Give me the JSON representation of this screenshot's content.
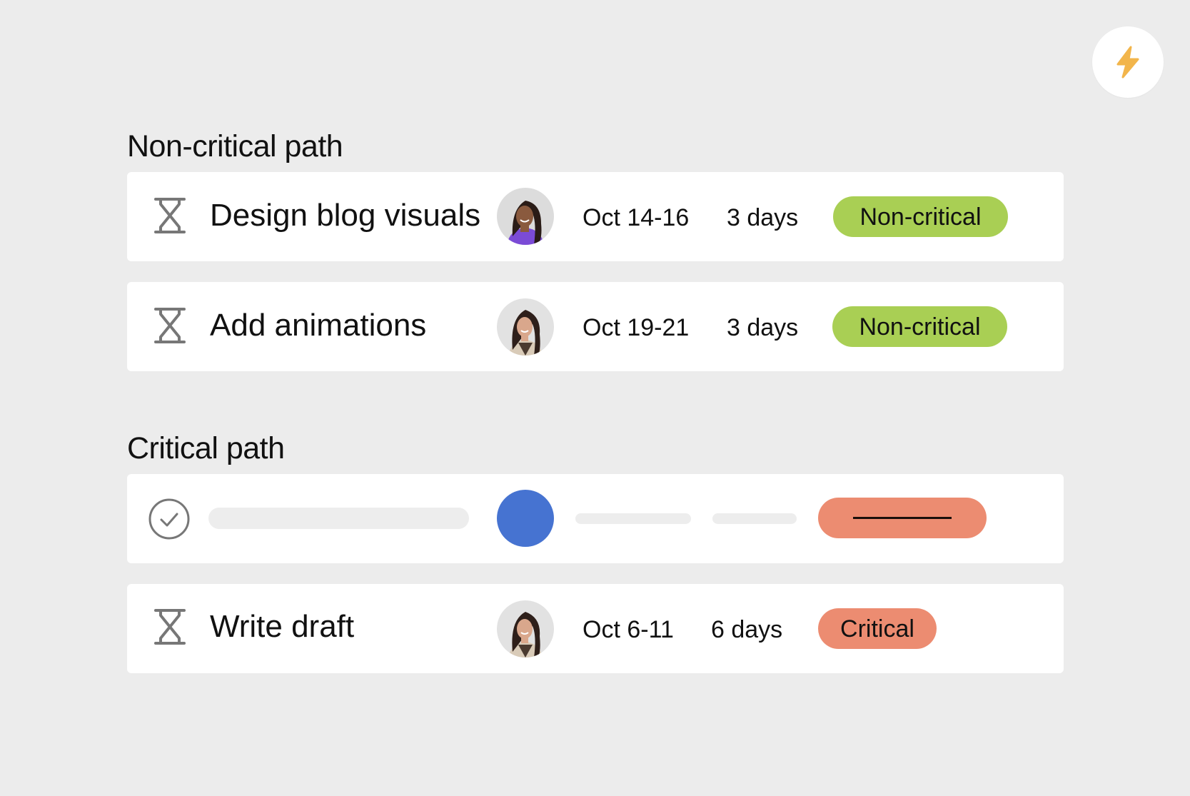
{
  "quick_action": {
    "icon": "lightning-bolt-icon",
    "color": "#f2b54b"
  },
  "sections": [
    {
      "title": "Non-critical path",
      "tasks": [
        {
          "name": "Design blog visuals",
          "icon": "hourglass-icon",
          "assignee_avatar": "avatar-woman-purple-top",
          "dates": "Oct 14-16",
          "duration": "3 days",
          "status": "Non-critical",
          "status_color": "#a9cf54"
        },
        {
          "name": "Add animations",
          "icon": "hourglass-icon",
          "assignee_avatar": "avatar-woman-patterned-top",
          "dates": "Oct 19-21",
          "duration": "3 days",
          "status": "Non-critical",
          "status_color": "#a9cf54"
        }
      ]
    },
    {
      "title": "Critical path",
      "placeholder_task": {
        "icon": "check-circle-icon",
        "avatar_color": "#4673d1",
        "status_color": "#ec8c71"
      },
      "tasks": [
        {
          "name": "Write draft",
          "icon": "hourglass-icon",
          "assignee_avatar": "avatar-woman-patterned-top",
          "dates": "Oct 6-11",
          "duration": "6 days",
          "status": "Critical",
          "status_color": "#ec8c71"
        }
      ]
    }
  ]
}
